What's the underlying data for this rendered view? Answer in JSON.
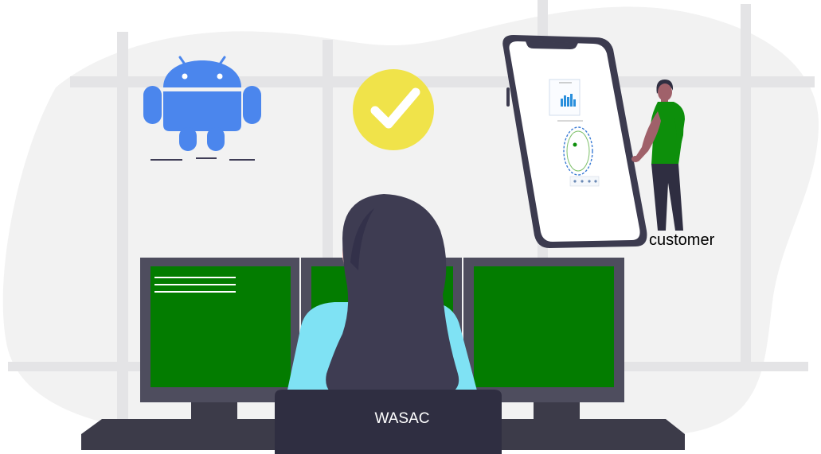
{
  "labels": {
    "customer": "customer",
    "chair": "WASAC"
  },
  "icons": {
    "robot": "android-robot-icon",
    "check": "check-circle-icon"
  },
  "colors": {
    "blob_background": "#f2f2f2",
    "window_frame": "#e4e4e6",
    "android_blue": "#4b86ed",
    "check_yellow": "#f0e34a",
    "monitor_screen": "#037c00",
    "monitor_frame": "#4e4d5e",
    "desk": "#3c3b49",
    "hair": "#3e3c52",
    "shirt": "#7fe2f4",
    "customer_shirt": "#0d8f0b",
    "phone_frame": "#3c3b4f"
  }
}
